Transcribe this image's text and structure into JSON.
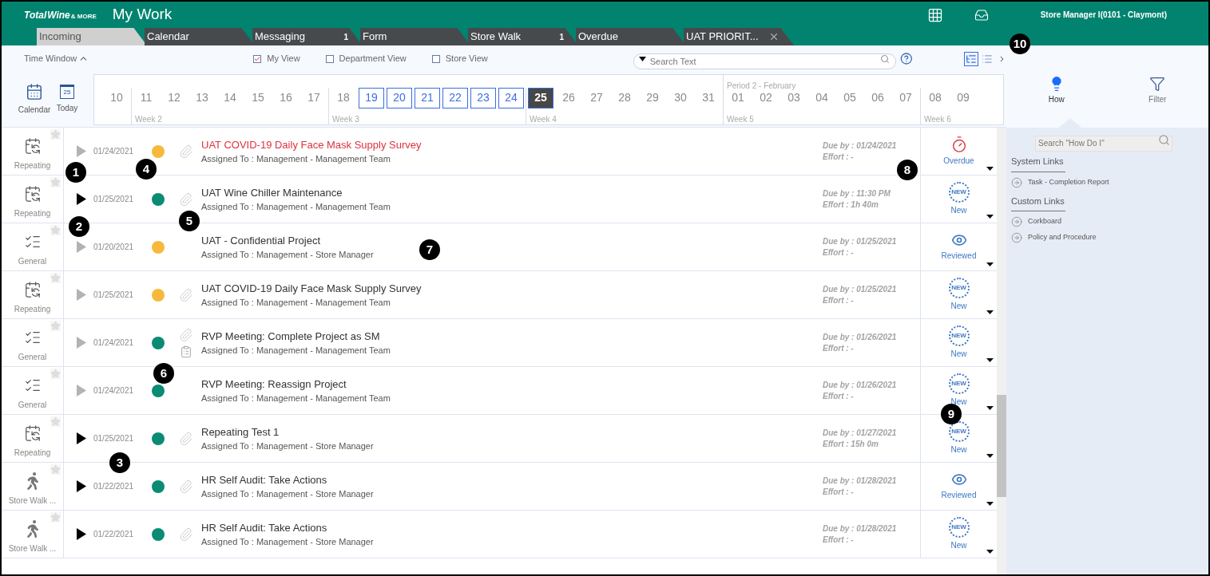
{
  "header": {
    "logo": {
      "brand": "Total",
      "brand_2": "Wine",
      "tagline": "& MORE"
    },
    "title": "My Work",
    "user": "Store Manager I(0101 - Claymont)"
  },
  "tabs": [
    {
      "label": "Incoming",
      "selected": true
    },
    {
      "label": "Calendar",
      "selected": false
    },
    {
      "label": "Messaging",
      "badge": "1",
      "selected": false
    },
    {
      "label": "Form",
      "selected": false
    },
    {
      "label": "Store Walk",
      "badge": "1",
      "selected": false
    },
    {
      "label": "Overdue",
      "selected": false
    },
    {
      "label": "UAT PRIORIT...",
      "closable": true,
      "selected": false
    }
  ],
  "toolbar": {
    "time_window": "Time Window",
    "views": [
      {
        "label": "My View",
        "checked": true
      },
      {
        "label": "Department View",
        "checked": false
      },
      {
        "label": "Store View",
        "checked": false
      }
    ],
    "search": {
      "placeholder": "Search Text"
    },
    "layout_modes": [
      {
        "kind": "tree",
        "selected": true
      },
      {
        "kind": "list",
        "selected": false
      }
    ]
  },
  "calendar_strip": {
    "calendar_button": "Calendar",
    "today_button": "Today",
    "today_icon_day": "25",
    "weeks": [
      {
        "days": [
          {
            "day": "10",
            "in_range": false,
            "selected": false
          }
        ]
      },
      {
        "label": "Week 2",
        "days": [
          {
            "day": "11",
            "in_range": false,
            "selected": false
          },
          {
            "day": "12",
            "in_range": false,
            "selected": false
          },
          {
            "day": "13",
            "in_range": false,
            "selected": false
          },
          {
            "day": "14",
            "in_range": false,
            "selected": false
          },
          {
            "day": "15",
            "in_range": false,
            "selected": false
          },
          {
            "day": "16",
            "in_range": false,
            "selected": false
          },
          {
            "day": "17",
            "in_range": false,
            "selected": false
          }
        ]
      },
      {
        "label": "Week 3",
        "days": [
          {
            "day": "18",
            "in_range": false,
            "selected": false
          },
          {
            "day": "19",
            "in_range": true,
            "selected": false
          },
          {
            "day": "20",
            "in_range": true,
            "selected": false
          },
          {
            "day": "21",
            "in_range": true,
            "selected": false
          },
          {
            "day": "22",
            "in_range": true,
            "selected": false
          },
          {
            "day": "23",
            "in_range": true,
            "selected": false
          },
          {
            "day": "24",
            "in_range": true,
            "selected": false
          }
        ]
      },
      {
        "label": "Week 4",
        "days": [
          {
            "day": "25",
            "in_range": true,
            "selected": true
          },
          {
            "day": "26",
            "in_range": false,
            "selected": false
          },
          {
            "day": "27",
            "in_range": false,
            "selected": false
          },
          {
            "day": "28",
            "in_range": false,
            "selected": false
          },
          {
            "day": "29",
            "in_range": false,
            "selected": false
          },
          {
            "day": "30",
            "in_range": false,
            "selected": false
          },
          {
            "day": "31",
            "in_range": false,
            "selected": false
          }
        ]
      },
      {
        "label": "Week 5",
        "period": "Period 2 - February",
        "days": [
          {
            "day": "01",
            "in_range": false,
            "selected": false
          },
          {
            "day": "02",
            "in_range": false,
            "selected": false
          },
          {
            "day": "03",
            "in_range": false,
            "selected": false
          },
          {
            "day": "04",
            "in_range": false,
            "selected": false
          },
          {
            "day": "05",
            "in_range": false,
            "selected": false
          },
          {
            "day": "06",
            "in_range": false,
            "selected": false
          },
          {
            "day": "07",
            "in_range": false,
            "selected": false
          }
        ]
      },
      {
        "label": "Week 6",
        "days": [
          {
            "day": "08",
            "in_range": false,
            "selected": false
          },
          {
            "day": "09",
            "in_range": false,
            "selected": false
          }
        ]
      }
    ]
  },
  "tasks": [
    {
      "kind": "repeating",
      "type_label": "Repeating",
      "playable": false,
      "date": "01/24/2021",
      "color": "#f6b93b",
      "attachment": true,
      "checklist": false,
      "title": "UAT COVID-19 Daily Face Mask Supply Survey",
      "overdue": true,
      "assigned": "Assigned To : Management - Management Team",
      "due": "Due by : 01/24/2021",
      "effort": "Effort : -",
      "status": {
        "kind": "overdue",
        "label": "Overdue"
      }
    },
    {
      "kind": "repeating",
      "type_label": "Repeating",
      "playable": true,
      "date": "01/25/2021",
      "color": "#0b8a74",
      "attachment": true,
      "checklist": false,
      "title": "UAT Wine Chiller Maintenance",
      "overdue": false,
      "assigned": "Assigned To : Management - Management Team",
      "due": "Due by : 11:30 PM",
      "effort": "Effort : 1h 40m",
      "status": {
        "kind": "new",
        "label": "New",
        "icon_text": "NEW"
      }
    },
    {
      "kind": "general",
      "type_label": "General",
      "playable": false,
      "date": "01/20/2021",
      "color": "#f6b93b",
      "attachment": false,
      "checklist": false,
      "title": "UAT - Confidential Project",
      "overdue": false,
      "assigned": "Assigned To : Management - Store Manager",
      "due": "Due by : 01/25/2021",
      "effort": "Effort : -",
      "status": {
        "kind": "reviewed",
        "label": "Reviewed"
      }
    },
    {
      "kind": "repeating",
      "type_label": "Repeating",
      "playable": false,
      "date": "01/25/2021",
      "color": "#f6b93b",
      "attachment": true,
      "checklist": false,
      "title": "UAT COVID-19 Daily Face Mask Supply Survey",
      "overdue": false,
      "assigned": "Assigned To : Management - Management Team",
      "due": "Due by : 01/25/2021",
      "effort": "Effort : -",
      "status": {
        "kind": "new",
        "label": "New",
        "icon_text": "NEW"
      }
    },
    {
      "kind": "general",
      "type_label": "General",
      "playable": false,
      "date": "01/24/2021",
      "color": "#0b8a74",
      "attachment": true,
      "checklist": true,
      "title": "RVP Meeting: Complete Project as SM",
      "overdue": false,
      "assigned": "Assigned To : Management - Management Team",
      "due": "Due by : 01/26/2021",
      "effort": "Effort : -",
      "status": {
        "kind": "new",
        "label": "New",
        "icon_text": "NEW"
      }
    },
    {
      "kind": "general",
      "type_label": "General",
      "playable": false,
      "date": "01/24/2021",
      "color": "#0b8a74",
      "attachment": false,
      "checklist": false,
      "title": "RVP Meeting: Reassign Project",
      "overdue": false,
      "assigned": "Assigned To : Management - Management Team",
      "due": "Due by : 01/26/2021",
      "effort": "Effort : -",
      "status": {
        "kind": "new",
        "label": "New",
        "icon_text": "NEW"
      }
    },
    {
      "kind": "repeating",
      "type_label": "Repeating",
      "playable": true,
      "date": "01/25/2021",
      "color": "#0b8a74",
      "attachment": true,
      "checklist": false,
      "title": "Repeating Test 1",
      "overdue": false,
      "assigned": "Assigned To : Management - Store Manager",
      "due": "Due by : 01/27/2021",
      "effort": "Effort : 15h 0m",
      "status": {
        "kind": "new",
        "label": "New",
        "icon_text": "NEW"
      }
    },
    {
      "kind": "store_walk",
      "type_label": "Store Walk ...",
      "playable": true,
      "date": "01/22/2021",
      "color": "#0b8a74",
      "attachment": true,
      "checklist": false,
      "title": "HR Self Audit: Take Actions",
      "overdue": false,
      "assigned": "Assigned To : Management - Store Manager",
      "due": "Due by : 01/28/2021",
      "effort": "Effort : -",
      "status": {
        "kind": "reviewed",
        "label": "Reviewed"
      }
    },
    {
      "kind": "store_walk",
      "type_label": "Store Walk ...",
      "playable": true,
      "date": "01/22/2021",
      "color": "#0b8a74",
      "attachment": true,
      "checklist": false,
      "title": "HR Self Audit: Take Actions",
      "overdue": false,
      "assigned": "Assigned To : Management - Store Manager",
      "due": "Due by : 01/28/2021",
      "effort": "Effort : -",
      "status": {
        "kind": "new",
        "label": "New",
        "icon_text": "NEW"
      }
    }
  ],
  "side_panel": {
    "modes": [
      {
        "kind": "how",
        "label": "How",
        "selected": true
      },
      {
        "kind": "filter",
        "label": "Filter",
        "selected": false
      }
    ],
    "search": {
      "placeholder": "Search \"How Do I\""
    },
    "sections": [
      {
        "title": "System Links",
        "links": [
          "Task - Completion Report"
        ]
      },
      {
        "title": "Custom Links",
        "links": [
          "Corkboard",
          "Policy and Procedure"
        ]
      }
    ]
  },
  "callouts": [
    "1",
    "2",
    "3",
    "4",
    "5",
    "6",
    "7",
    "8",
    "9",
    "10"
  ]
}
